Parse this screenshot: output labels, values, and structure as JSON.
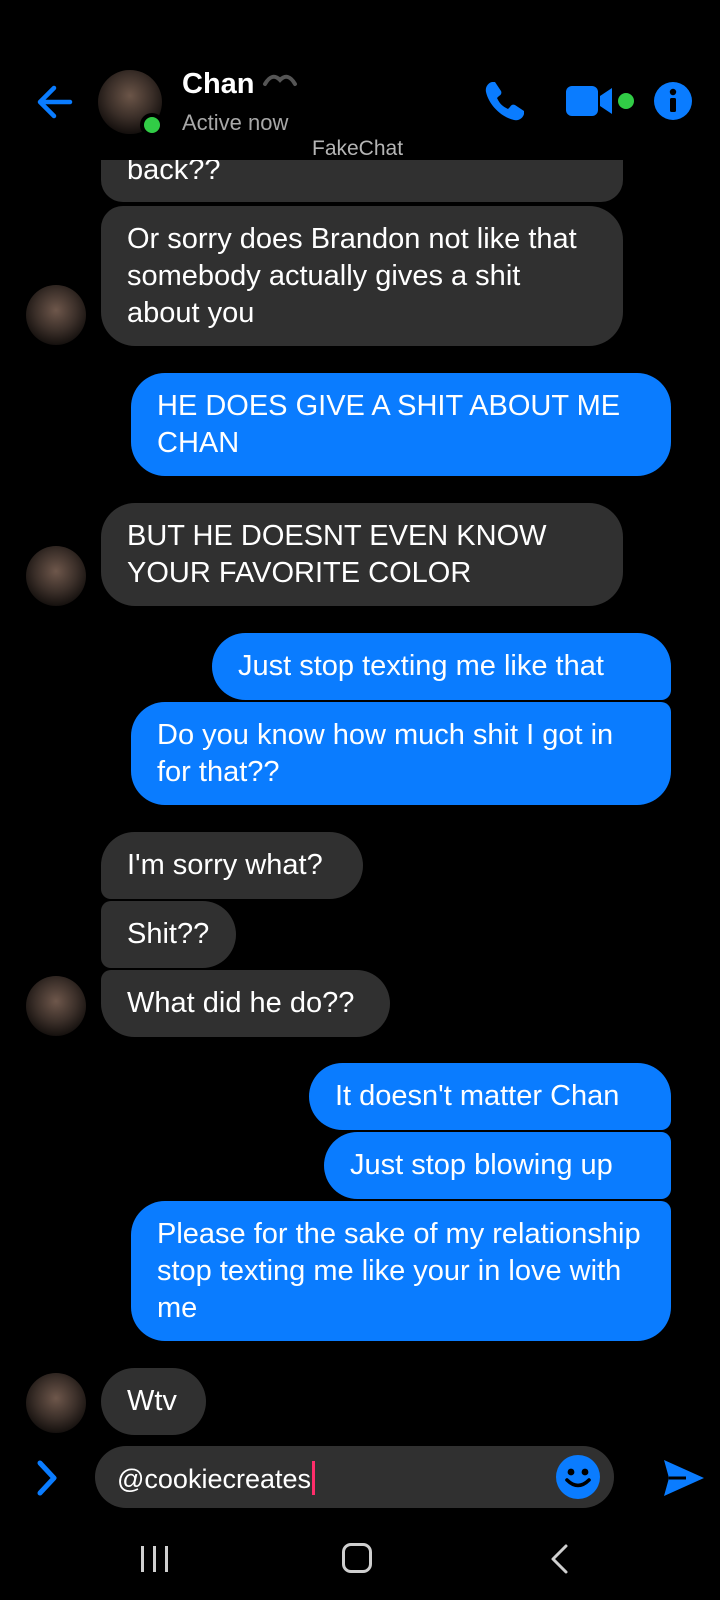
{
  "header": {
    "contact_name": "Chan",
    "status": "Active now",
    "watermark": "FakeChat"
  },
  "messages": [
    {
      "dir": "in",
      "text": "back??"
    },
    {
      "dir": "in",
      "text": "Or sorry does Brandon not like that somebody actually gives a shit about you"
    },
    {
      "dir": "out",
      "text": "HE DOES GIVE A SHIT ABOUT ME CHAN"
    },
    {
      "dir": "in",
      "text": "BUT HE DOESNT EVEN KNOW YOUR FAVORITE COLOR"
    },
    {
      "dir": "out",
      "text": "Just stop texting me like that"
    },
    {
      "dir": "out",
      "text": "Do you know how much shit I got in for that??"
    },
    {
      "dir": "in",
      "text": "I'm sorry what?"
    },
    {
      "dir": "in",
      "text": "Shit??"
    },
    {
      "dir": "in",
      "text": "What did he do??"
    },
    {
      "dir": "out",
      "text": "It doesn't matter Chan"
    },
    {
      "dir": "out",
      "text": "Just stop blowing up"
    },
    {
      "dir": "out",
      "text": "Please for the sake of my relationship stop texting me like your in love with me"
    },
    {
      "dir": "in",
      "text": "Wtv"
    }
  ],
  "composer": {
    "value": "@cookiecreates"
  },
  "icons": {
    "back": "arrow-left-icon",
    "call": "phone-icon",
    "video": "video-camera-icon",
    "info": "info-icon",
    "expand": "chevron-right-icon",
    "emoji": "smiley-icon",
    "send": "send-icon"
  },
  "colors": {
    "accent": "#0a7cff",
    "incoming_bubble": "#303030",
    "online": "#31cc46",
    "background": "#000000"
  }
}
